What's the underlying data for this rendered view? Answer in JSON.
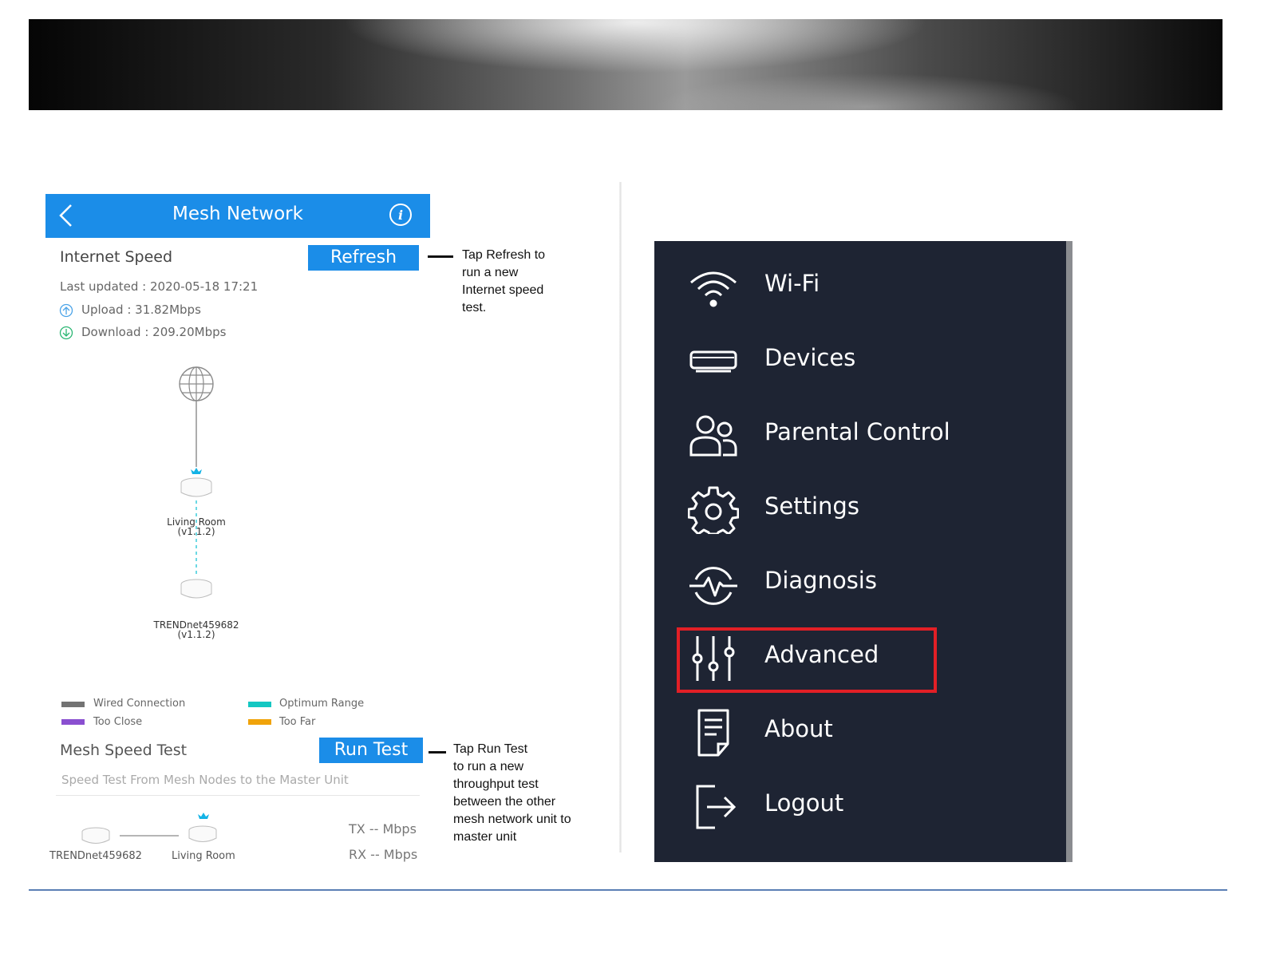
{
  "app": {
    "title": "Mesh Network",
    "accent": "#1b8de8"
  },
  "internet_speed": {
    "title": "Internet Speed",
    "refresh_label": "Refresh",
    "last_updated": "Last updated : 2020-05-18 17:21",
    "upload": "Upload : 31.82Mbps",
    "download": "Download : 209.20Mbps"
  },
  "topology": {
    "node1_name": "Living Room",
    "node1_version": "(v1.1.2)",
    "node2_name": "TRENDnet459682",
    "node2_version": "(v1.1.2)"
  },
  "legend": [
    {
      "label": "Wired Connection",
      "color": "#737373"
    },
    {
      "label": "Too Close",
      "color": "#8a4fd0"
    },
    {
      "label": "Optimum Range",
      "color": "#14c7c2"
    },
    {
      "label": "Too Far",
      "color": "#f0a30a"
    }
  ],
  "mesh_speed": {
    "title": "Mesh Speed Test",
    "run_label": "Run Test",
    "subtitle": "Speed Test From Mesh Nodes to the Master Unit",
    "node_a": "TRENDnet459682",
    "node_b": "Living Room",
    "tx": "TX -- Mbps",
    "rx": "RX -- Mbps"
  },
  "notes": {
    "refresh_note": [
      "Tap Refresh to",
      "run a new",
      "Internet speed",
      "test."
    ],
    "run_note": [
      "Tap Run Test",
      "to run a new",
      "throughput test",
      "between the other",
      "mesh network unit to",
      "master unit"
    ]
  },
  "menu": {
    "items": [
      {
        "label": "Wi-Fi",
        "icon": "wifi-icon"
      },
      {
        "label": "Devices",
        "icon": "router-icon"
      },
      {
        "label": "Parental Control",
        "icon": "users-icon"
      },
      {
        "label": "Settings",
        "icon": "gear-icon"
      },
      {
        "label": "Diagnosis",
        "icon": "pulse-icon"
      },
      {
        "label": "Advanced",
        "icon": "sliders-icon"
      },
      {
        "label": "About",
        "icon": "document-icon"
      },
      {
        "label": "Logout",
        "icon": "logout-icon"
      }
    ],
    "highlighted": "Advanced",
    "highlight_color": "#e21f26",
    "background": "#1e2433"
  }
}
